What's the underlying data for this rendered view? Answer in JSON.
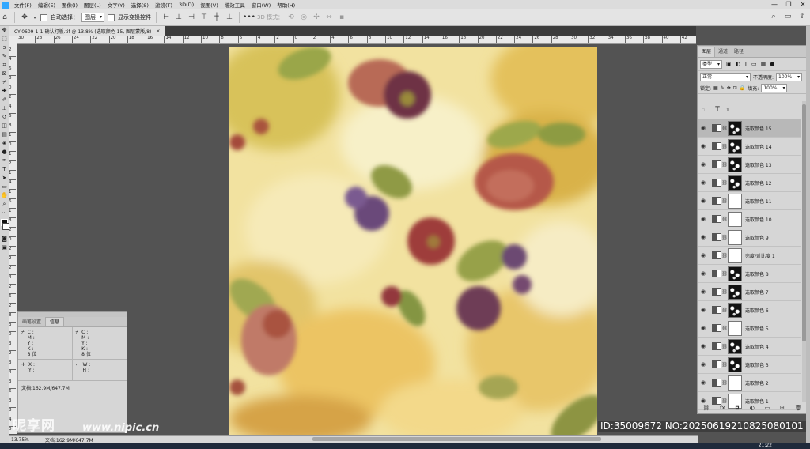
{
  "menubar": {
    "items": [
      "文件(F)",
      "编辑(E)",
      "图像(I)",
      "图层(L)",
      "文字(Y)",
      "选择(S)",
      "滤镜(T)",
      "3D(D)",
      "视图(V)",
      "增效工具",
      "窗口(W)",
      "帮助(H)"
    ],
    "window_controls": [
      "—",
      "❐",
      "✕"
    ]
  },
  "options_bar": {
    "auto_select_label": "自动选择：",
    "auto_select_value": "图层",
    "transform_label": "显示变换控件",
    "mode_3d_label": "3D 模式："
  },
  "document_tab": {
    "title": "CY-0609-1-1-确认打板.tif @ 13.8% (选取颜色 15, 图层蒙版/8)",
    "close": "×"
  },
  "rulers": {
    "horizontal": [
      "30",
      "28",
      "26",
      "24",
      "22",
      "20",
      "18",
      "16",
      "14",
      "12",
      "10",
      "8",
      "6",
      "4",
      "2",
      "0",
      "2",
      "4",
      "6",
      "8",
      "10",
      "12",
      "14",
      "16",
      "18",
      "20",
      "22",
      "24",
      "26",
      "28",
      "30",
      "32",
      "34",
      "36",
      "38",
      "40",
      "42",
      "44"
    ],
    "vertical": [
      "2",
      "4",
      "6",
      "8",
      "0",
      "2",
      "4",
      "6",
      "8",
      "1",
      "0",
      "1",
      "2",
      "1",
      "4",
      "1",
      "6",
      "1",
      "8",
      "2",
      "0",
      "2",
      "2",
      "2",
      "4",
      "2",
      "6",
      "2",
      "8",
      "3",
      "0",
      "3",
      "2",
      "3",
      "4",
      "3",
      "6",
      "3",
      "8",
      "4",
      "0"
    ]
  },
  "info_panel": {
    "tabs": [
      "画笔设置",
      "信息"
    ],
    "active_tab": "信息",
    "cmyk_left": [
      "C :",
      "M :",
      "Y :",
      "K :",
      "8 位"
    ],
    "cmyk_right": [
      "C :",
      "M :",
      "Y :",
      "K :",
      "8 位"
    ],
    "xy": [
      "X :",
      "Y :"
    ],
    "wh": [
      "W :",
      "H :"
    ],
    "doc_line": "文档:162.9M/647.7M"
  },
  "status_bar": {
    "zoom": "13.75%",
    "doc": "文档:162.9M/647.7M"
  },
  "layers_panel": {
    "tabs": [
      "图层",
      "通道",
      "路径"
    ],
    "active_tab": "图层",
    "filter_kind": "类型",
    "blend_mode": "正常",
    "opacity_label": "不透明度:",
    "opacity_value": "100%",
    "lock_label": "锁定:",
    "fill_label": "填充:",
    "fill_value": "100%",
    "text_layer": "1",
    "layers": [
      {
        "name": "选取颜色 15",
        "mask": "dark",
        "selected": true
      },
      {
        "name": "选取颜色 14",
        "mask": "dark",
        "selected": false
      },
      {
        "name": "选取颜色 13",
        "mask": "dark",
        "selected": false
      },
      {
        "name": "选取颜色 12",
        "mask": "dark",
        "selected": false
      },
      {
        "name": "选取颜色 11",
        "mask": "white",
        "selected": false
      },
      {
        "name": "选取颜色 10",
        "mask": "white",
        "selected": false
      },
      {
        "name": "选取颜色 9",
        "mask": "white",
        "selected": false
      },
      {
        "name": "亮度/对比度 1",
        "mask": "white",
        "selected": false
      },
      {
        "name": "选取颜色 8",
        "mask": "dark",
        "selected": false
      },
      {
        "name": "选取颜色 7",
        "mask": "dark",
        "selected": false
      },
      {
        "name": "选取颜色 6",
        "mask": "dark",
        "selected": false
      },
      {
        "name": "选取颜色 5",
        "mask": "white",
        "selected": false
      },
      {
        "name": "选取颜色 4",
        "mask": "dark",
        "selected": false
      },
      {
        "name": "选取颜色 3",
        "mask": "dark",
        "selected": false
      },
      {
        "name": "选取颜色 2",
        "mask": "white",
        "selected": false
      },
      {
        "name": "选取颜色 1",
        "mask": "white",
        "selected": false
      }
    ]
  },
  "watermark": {
    "logo": "昵享网",
    "url": "www.nipic.cn",
    "id": "ID:35009672 NO:20250619210825080101"
  },
  "taskbar": {
    "clock": "21:22"
  }
}
